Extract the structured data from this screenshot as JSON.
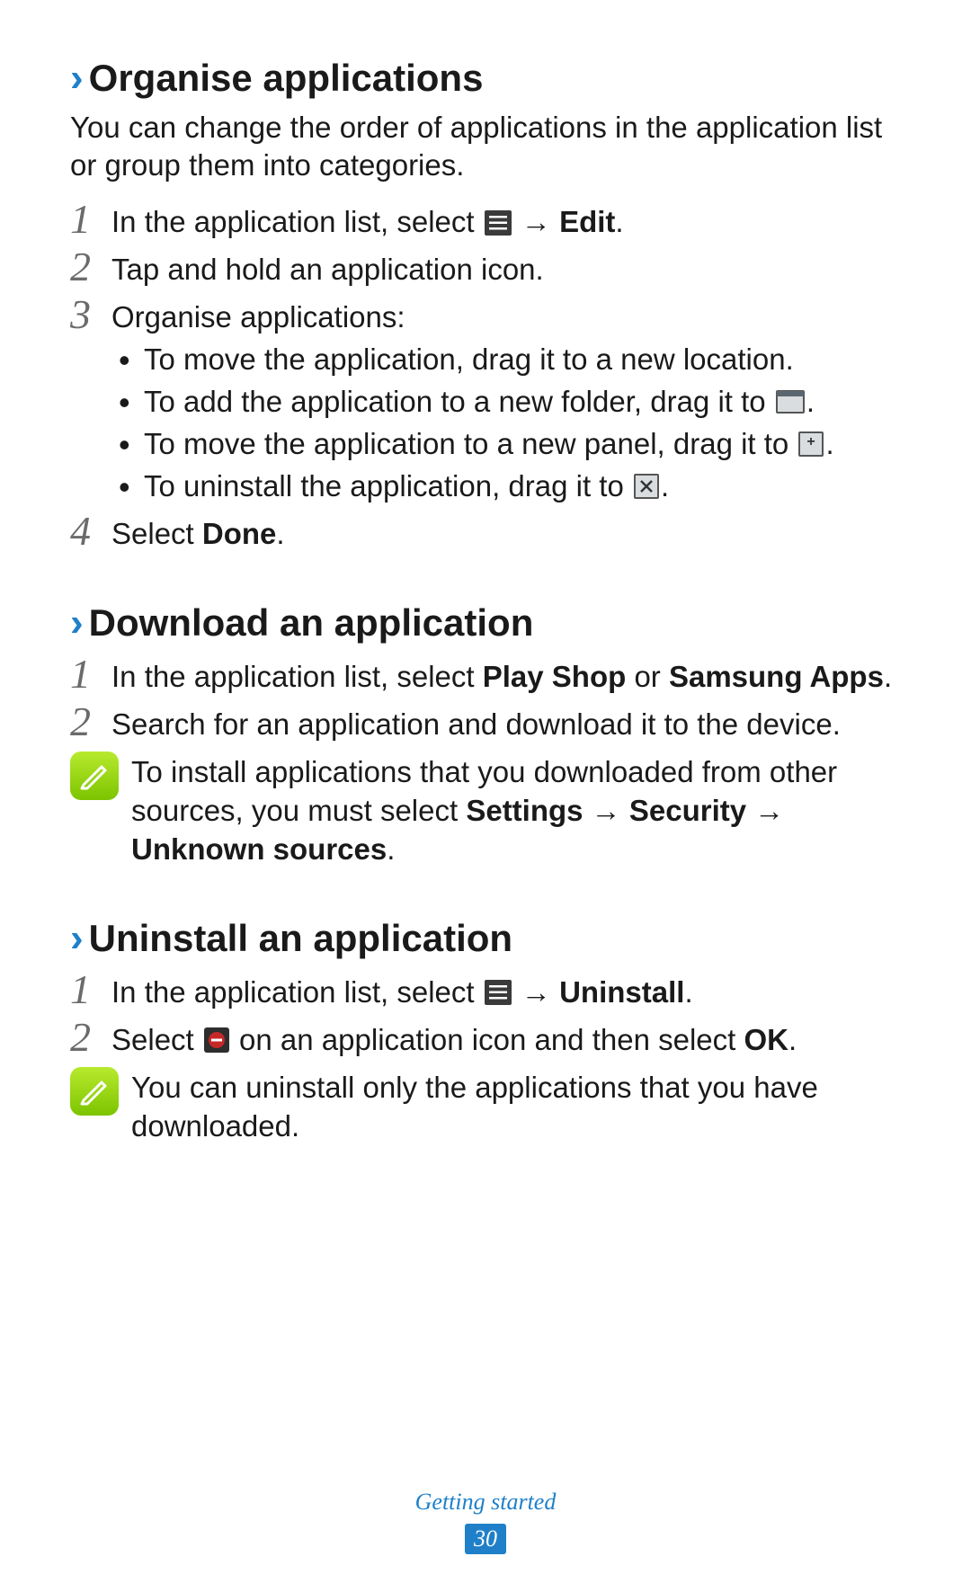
{
  "sections": {
    "organise": {
      "heading": "Organise applications",
      "intro": "You can change the order of applications in the application list or group them into categories.",
      "step1_pre": "In the application list, select ",
      "step1_post_arrow": " → ",
      "step1_edit": "Edit",
      "step1_period": ".",
      "step2": "Tap and hold an application icon.",
      "step3_head": "Organise applications:",
      "bullet1": "To move the application, drag it to a new location.",
      "bullet2_pre": "To add the application to a new folder, drag it to ",
      "bullet2_post": ".",
      "bullet3_pre": "To move the application to a new panel, drag it to ",
      "bullet3_post": ".",
      "bullet4_pre": "To uninstall the application, drag it to ",
      "bullet4_post": ".",
      "step4_pre": "Select ",
      "step4_done": "Done",
      "step4_post": "."
    },
    "download": {
      "heading": "Download an application",
      "step1_pre": "In the application list, select ",
      "step1_playshop": "Play Shop",
      "step1_or": " or ",
      "step1_samsung": "Samsung Apps",
      "step1_post": ".",
      "step2": "Search for an application and download it to the device.",
      "note_pre": "To install applications that you downloaded from other sources, you must select ",
      "note_settings": "Settings",
      "note_arrow1": " → ",
      "note_security": "Security",
      "note_arrow2": " → ",
      "note_unknown": "Unknown sources",
      "note_post": "."
    },
    "uninstall": {
      "heading": "Uninstall an application",
      "step1_pre": "In the application list, select ",
      "step1_arrow": " → ",
      "step1_uninstall": "Uninstall",
      "step1_post": ".",
      "step2_pre": "Select ",
      "step2_mid": " on an application icon and then select ",
      "step2_ok": "OK",
      "step2_post": ".",
      "note": "You can uninstall only the applications that you have downloaded."
    }
  },
  "numbers": {
    "n1": "1",
    "n2": "2",
    "n3": "3",
    "n4": "4"
  },
  "footer": {
    "section": "Getting started",
    "page": "30"
  }
}
